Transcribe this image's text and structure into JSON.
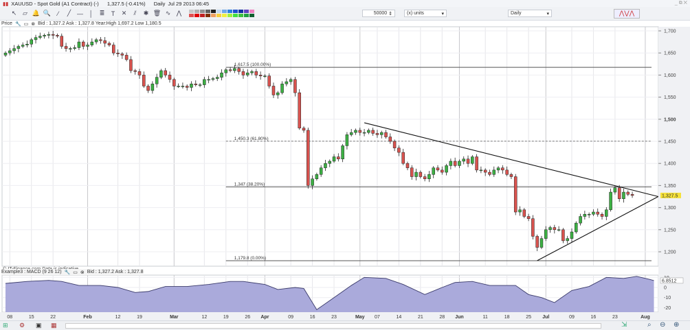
{
  "window": {
    "title": "XAUUSD - Spot Gold (A1 Contract) (-)",
    "last": "1,327.5 (-0.41%)",
    "period": "Daily",
    "datetime": "Jul 29 2013 06:45",
    "controls": "_ ⧉ ✕"
  },
  "toolbar": {
    "quantity": "50000",
    "units": "(x) units",
    "interval": "Daily",
    "tools": [
      "pointer-icon",
      "ruler-icon",
      "alert-icon",
      "zoom-icon",
      "trendline-icon",
      "line-icon",
      "horizontal-line-icon",
      "vertical-line-icon",
      "fibonacci-icon",
      "text-icon",
      "cross-icon",
      "channel-icon",
      "magic-icon",
      "trash-icon",
      "indicator-icon",
      "pattern-icon"
    ],
    "colors": [
      "#c8c8c8",
      "#b0b0b0",
      "#909090",
      "#606060",
      "#202020",
      "#c0d8f0",
      "#6fa8e8",
      "#2a7fe0",
      "#1d4fd0",
      "#1030a0",
      "#6040c0",
      "#f080c0",
      "#e05050",
      "#e00000",
      "#c02020",
      "#803000",
      "#f0a060",
      "#f8d040",
      "#f0f040",
      "#a0f040",
      "#40e040",
      "#40c040",
      "#20a040",
      "#106030"
    ]
  },
  "price_header": {
    "label": "Price",
    "quote": "Bid : 1,327.2 Ask : 1,327.8 Year:High 1,697.2 Low 1,180.5"
  },
  "watermark": "© IT-Finance.com  Data is indicative",
  "macd_header": {
    "label": "Example3 : MACD (9 26 12)",
    "quote": "Bid : 1,327.2 Ask : 1,327.8"
  },
  "current_price_label": "1,327.5",
  "macd_value_label": "6.8512",
  "chart_data": [
    {
      "type": "candlestick",
      "title": "XAUUSD - Spot Gold (A1 Contract) Daily",
      "ylim": [
        1160,
        1720
      ],
      "yticks": [
        "1,700",
        "1,650",
        "1,600",
        "1,550",
        "1,500",
        "1,450",
        "1,400",
        "1,350",
        "1,300",
        "1,250",
        "1,200"
      ],
      "ytick_values": [
        1700,
        1650,
        1600,
        1550,
        1500,
        1450,
        1400,
        1350,
        1300,
        1250,
        1200
      ],
      "xticks": [
        {
          "label": "08",
          "day": 1
        },
        {
          "label": "15",
          "day": 6
        },
        {
          "label": "22",
          "day": 11
        },
        {
          "label": "Feb",
          "day": 19,
          "bold": true
        },
        {
          "label": "12",
          "day": 26
        },
        {
          "label": "19",
          "day": 31
        },
        {
          "label": "Mar",
          "day": 39,
          "bold": true
        },
        {
          "label": "12",
          "day": 46
        },
        {
          "label": "19",
          "day": 51
        },
        {
          "label": "26",
          "day": 56
        },
        {
          "label": "Apr",
          "day": 60,
          "bold": true
        },
        {
          "label": "09",
          "day": 66
        },
        {
          "label": "16",
          "day": 71
        },
        {
          "label": "23",
          "day": 76
        },
        {
          "label": "May",
          "day": 82,
          "bold": true
        },
        {
          "label": "07",
          "day": 86
        },
        {
          "label": "14",
          "day": 91
        },
        {
          "label": "21",
          "day": 96
        },
        {
          "label": "28",
          "day": 101
        },
        {
          "label": "Jun",
          "day": 105,
          "bold": true
        },
        {
          "label": "11",
          "day": 111
        },
        {
          "label": "18",
          "day": 116
        },
        {
          "label": "25",
          "day": 121
        },
        {
          "label": "Jul",
          "day": 125,
          "bold": true
        },
        {
          "label": "09",
          "day": 131
        },
        {
          "label": "16",
          "day": 136
        },
        {
          "label": "23",
          "day": 141
        },
        {
          "label": "Aug",
          "day": 148,
          "bold": true
        }
      ],
      "start_open": 1645,
      "closes": [
        1650,
        1655,
        1660,
        1665,
        1668,
        1670,
        1680,
        1685,
        1688,
        1690,
        1692,
        1690,
        1688,
        1665,
        1660,
        1660,
        1662,
        1675,
        1665,
        1668,
        1675,
        1680,
        1678,
        1672,
        1668,
        1650,
        1648,
        1645,
        1635,
        1610,
        1608,
        1600,
        1575,
        1565,
        1580,
        1595,
        1610,
        1600,
        1590,
        1575,
        1575,
        1575,
        1572,
        1580,
        1578,
        1578,
        1590,
        1590,
        1592,
        1595,
        1605,
        1612,
        1610,
        1615,
        1608,
        1600,
        1605,
        1608,
        1600,
        1598,
        1598,
        1575,
        1555,
        1560,
        1580,
        1585,
        1590,
        1560,
        1480,
        1475,
        1350,
        1365,
        1375,
        1390,
        1400,
        1405,
        1415,
        1410,
        1440,
        1465,
        1470,
        1475,
        1470,
        1470,
        1475,
        1468,
        1465,
        1470,
        1460,
        1450,
        1435,
        1425,
        1400,
        1390,
        1370,
        1380,
        1370,
        1365,
        1375,
        1390,
        1385,
        1380,
        1395,
        1405,
        1395,
        1405,
        1410,
        1400,
        1415,
        1385,
        1385,
        1380,
        1375,
        1385,
        1390,
        1385,
        1375,
        1370,
        1290,
        1295,
        1280,
        1275,
        1235,
        1210,
        1230,
        1250,
        1255,
        1250,
        1250,
        1225,
        1230,
        1245,
        1265,
        1280,
        1285,
        1285,
        1290,
        1285,
        1280,
        1295,
        1335,
        1345,
        1320,
        1335,
        1330,
        1327.5
      ],
      "fibonacci": [
        {
          "label": "1,617.5 (100.00%)",
          "price": 1617.5,
          "style": "solid"
        },
        {
          "label": "1,450.3 (61.80%)",
          "price": 1450.3,
          "style": "dashed"
        },
        {
          "label": "1,347 (38.20%)",
          "price": 1347,
          "style": "solid"
        },
        {
          "label": "1,179.8 (0.00%)",
          "price": 1179.8,
          "style": "solid"
        }
      ],
      "fib_start_day": 51,
      "trendlines": [
        {
          "from": {
            "day": 83,
            "price": 1492
          },
          "to": {
            "day": 151,
            "price": 1325
          }
        },
        {
          "from": {
            "day": 123,
            "price": 1180
          },
          "to": {
            "day": 151,
            "price": 1325
          }
        }
      ],
      "colors": {
        "up": "#3cb043",
        "down": "#d9534f"
      }
    },
    {
      "type": "area",
      "title": "MACD (9 26 12)",
      "ylim": [
        -25,
        12
      ],
      "yticks": [
        "10",
        "0",
        "-10",
        "-20"
      ],
      "ytick_values": [
        10,
        0,
        -10,
        -20
      ],
      "points": [
        [
          0,
          4
        ],
        [
          5,
          6
        ],
        [
          10,
          7
        ],
        [
          13,
          6
        ],
        [
          17,
          2
        ],
        [
          22,
          2
        ],
        [
          26,
          0
        ],
        [
          30,
          -5
        ],
        [
          33,
          -4
        ],
        [
          37,
          1
        ],
        [
          42,
          1
        ],
        [
          47,
          3
        ],
        [
          52,
          6
        ],
        [
          55,
          6
        ],
        [
          60,
          3
        ],
        [
          63,
          -2
        ],
        [
          67,
          0
        ],
        [
          69,
          -1
        ],
        [
          72,
          -22
        ],
        [
          76,
          -10
        ],
        [
          80,
          2
        ],
        [
          83,
          10
        ],
        [
          88,
          9
        ],
        [
          92,
          3
        ],
        [
          97,
          -7
        ],
        [
          101,
          0
        ],
        [
          104,
          5
        ],
        [
          108,
          6
        ],
        [
          112,
          2
        ],
        [
          118,
          2
        ],
        [
          121,
          -7
        ],
        [
          124,
          -10
        ],
        [
          127,
          -15
        ],
        [
          131,
          -3
        ],
        [
          135,
          1
        ],
        [
          139,
          10
        ],
        [
          143,
          9
        ],
        [
          146,
          11
        ],
        [
          149,
          8
        ],
        [
          150,
          6.85
        ]
      ],
      "colors": {
        "fill": "#aaaadb",
        "line": "#3a3a6a"
      }
    }
  ]
}
